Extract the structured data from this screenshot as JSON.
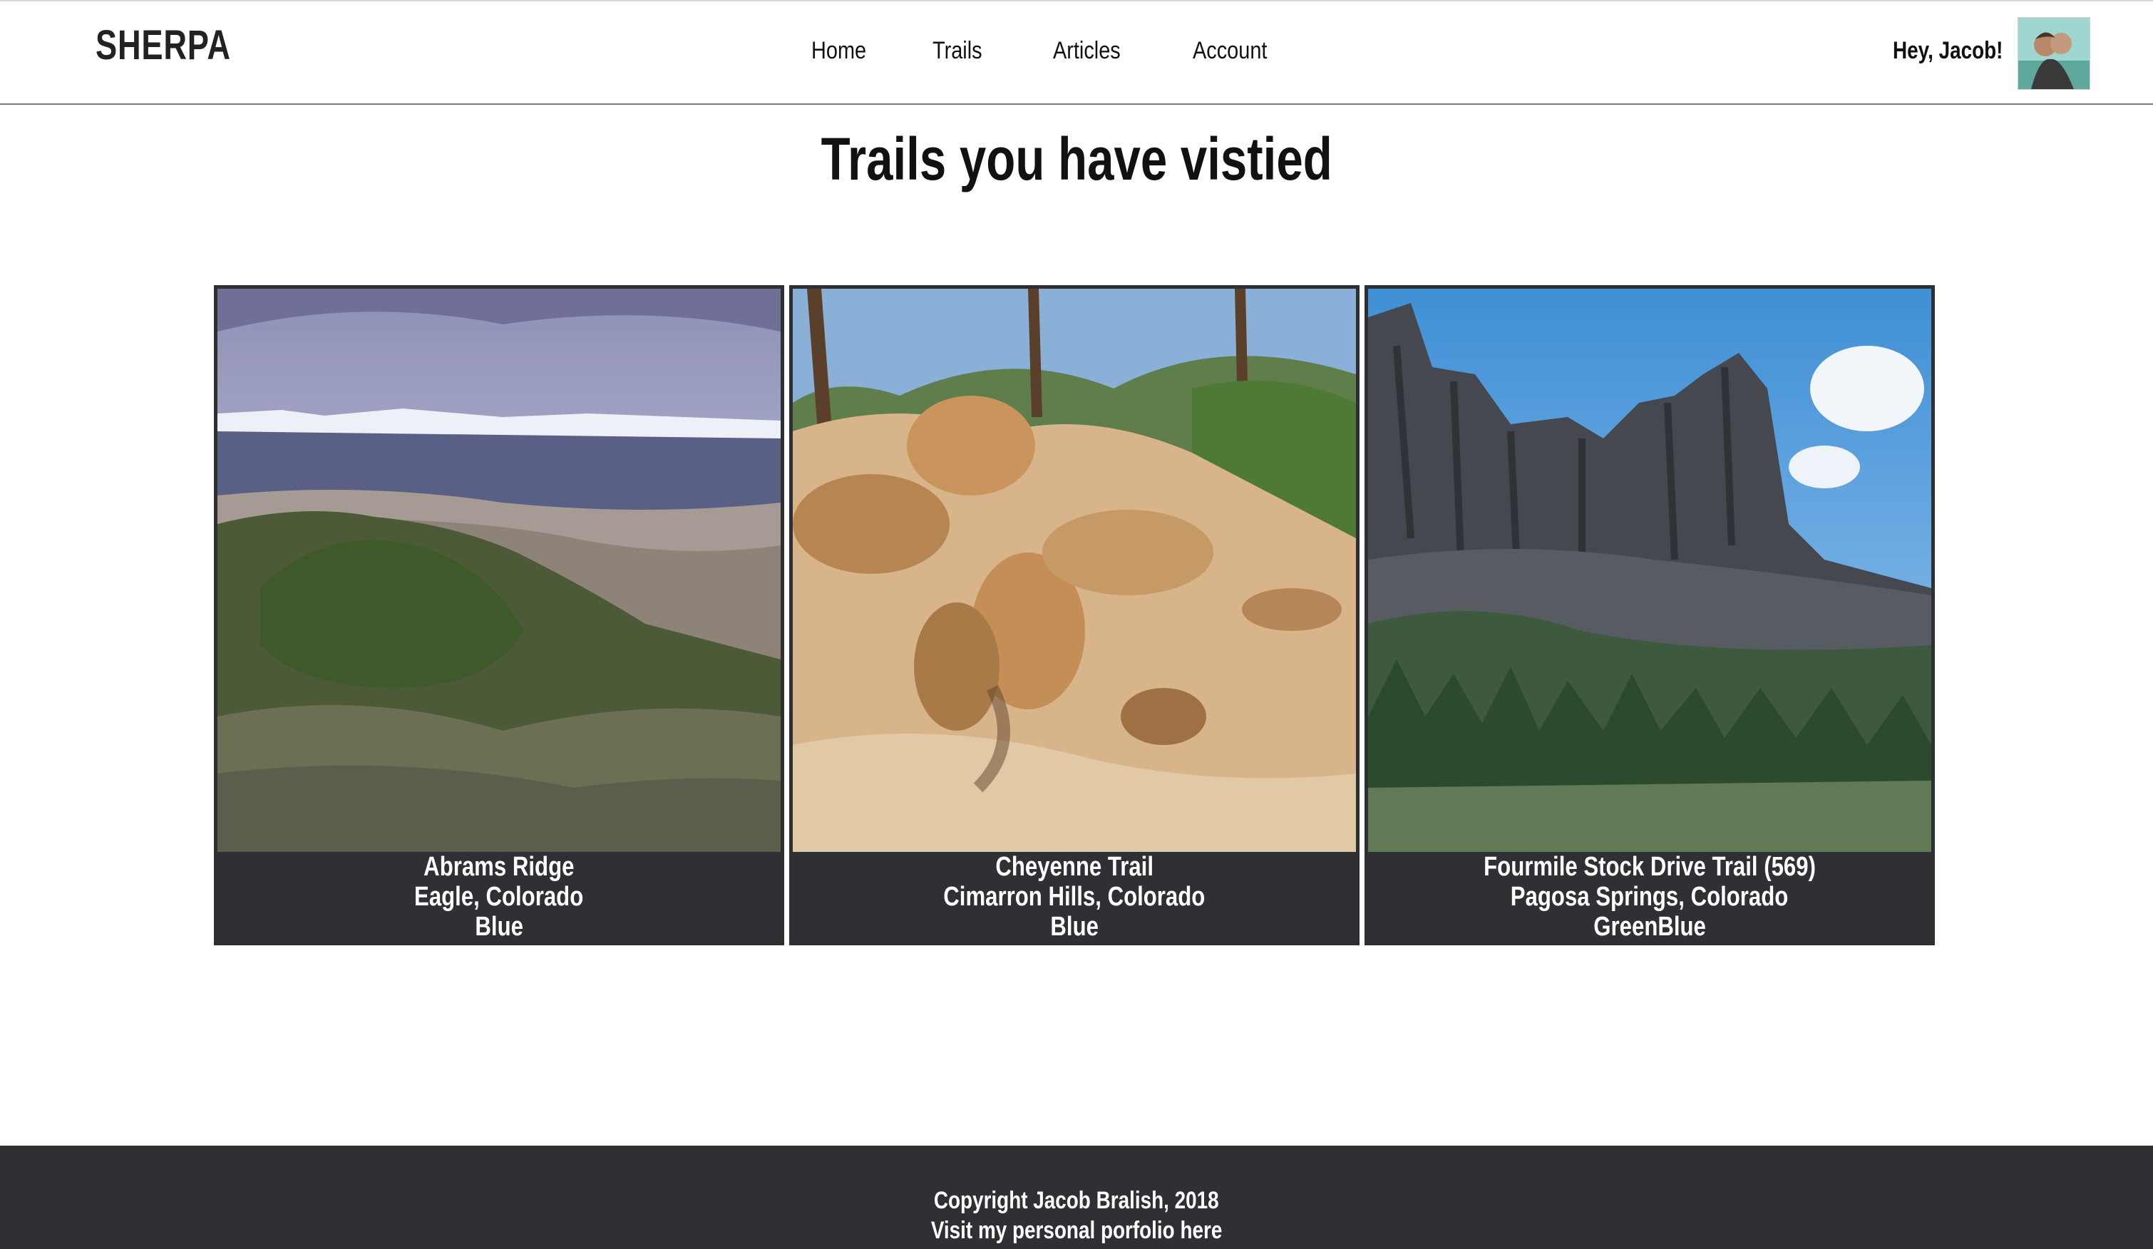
{
  "brand": {
    "name": "SHERPA"
  },
  "nav": {
    "links": [
      "Home",
      "Trails",
      "Articles",
      "Account"
    ]
  },
  "user": {
    "greeting": "Hey, Jacob!"
  },
  "page": {
    "title": "Trails you have vistied"
  },
  "trails": [
    {
      "name": "Abrams Ridge",
      "location": "Eagle, Colorado",
      "difficulty": "Blue"
    },
    {
      "name": "Cheyenne Trail",
      "location": "Cimarron Hills, Colorado",
      "difficulty": "Blue"
    },
    {
      "name": "Fourmile Stock Drive Trail (569)",
      "location": "Pagosa Springs, Colorado",
      "difficulty": "GreenBlue"
    }
  ],
  "footer": {
    "copyright": "Copyright Jacob Bralish, 2018",
    "portfolio_link": "Visit my personal porfolio here"
  },
  "colors": {
    "footer_bg": "#2f3034",
    "card_caption_bg": "#2f3034",
    "header_border": "#7a7a7a"
  }
}
